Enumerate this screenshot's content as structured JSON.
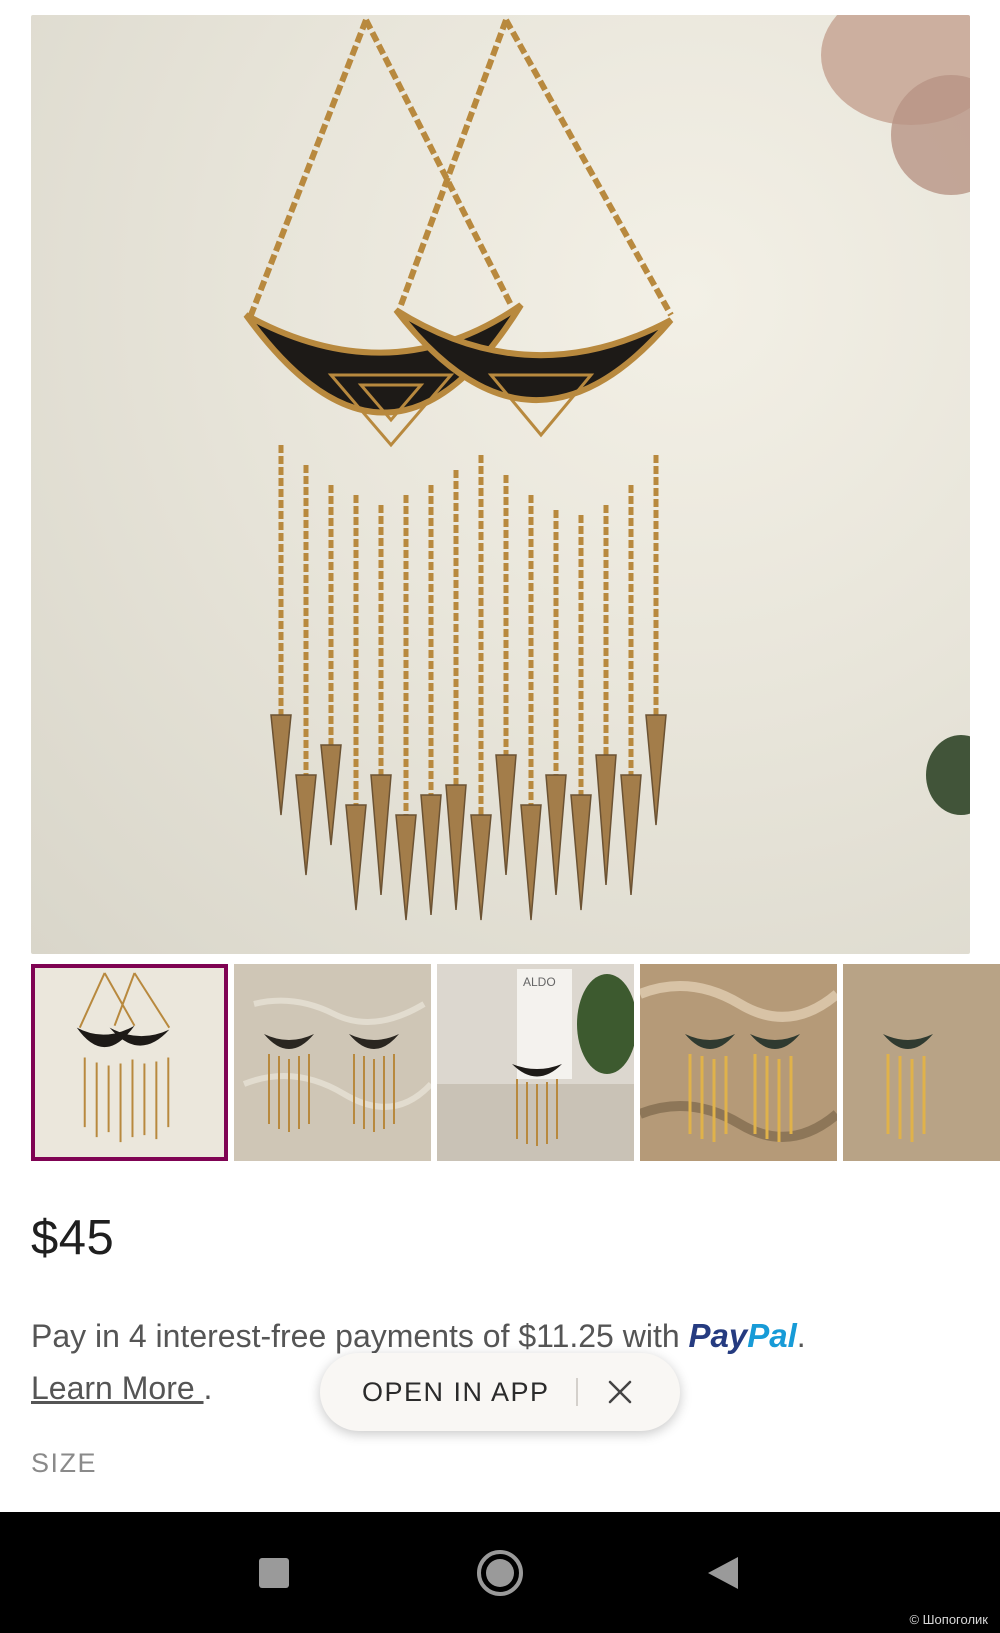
{
  "product": {
    "price": "$45",
    "payment_text": "Pay in 4 interest-free payments of $11.25 with ",
    "paypal_pay": "Pay",
    "paypal_pal": "Pal",
    "period": ".",
    "learn_more": "Learn More ",
    "learn_more_period": ".",
    "size_label": "SIZE"
  },
  "thumbnails": [
    {
      "label": "photo 1",
      "selected": true
    },
    {
      "label": "photo 2",
      "selected": false
    },
    {
      "label": "photo 3",
      "selected": false,
      "tag_text": "ALDO"
    },
    {
      "label": "photo 4",
      "selected": false
    },
    {
      "label": "photo 5",
      "selected": false
    }
  ],
  "banner": {
    "open_in_app": "OPEN IN APP"
  },
  "watermark": "© Шопоголик",
  "colors": {
    "selected_border": "#7f0353",
    "paypal_dark": "#253b80",
    "paypal_light": "#179bd7"
  }
}
